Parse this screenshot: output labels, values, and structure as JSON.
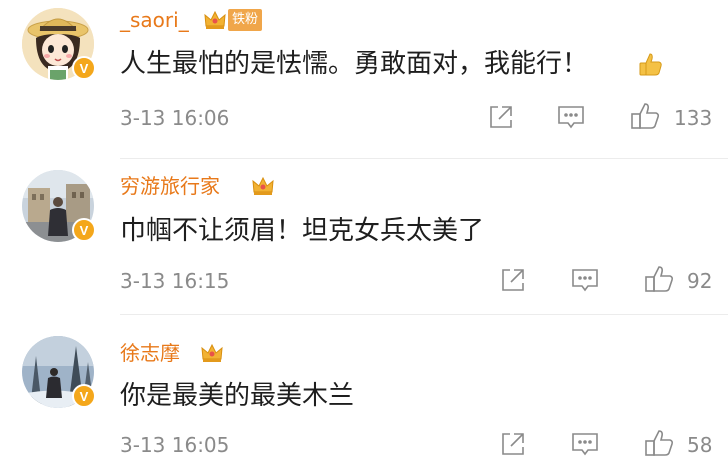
{
  "comments": [
    {
      "username": "_saori_",
      "fan_tag": "铁粉",
      "content": "人生最怕的是怯懦。勇敢面对，我能行！",
      "timestamp": "3-13 16:06",
      "likes": "133",
      "avatar_icon": "cartoon-girl-avatar",
      "content_emoji": "thumbs-up-emoji"
    },
    {
      "username": "穷游旅行家",
      "content": "巾帼不让须眉！坦克女兵太美了",
      "timestamp": "3-13 16:15",
      "likes": "92",
      "avatar_icon": "street-photo-avatar"
    },
    {
      "username": "徐志摩",
      "content": "你是最美的最美木兰",
      "timestamp": "3-13 16:05",
      "likes": "58",
      "avatar_icon": "snowy-trees-avatar"
    }
  ],
  "verified_badge": "V",
  "icons": {
    "share": "share-icon",
    "comment": "comment-icon",
    "like": "like-icon",
    "member": "crown-icon"
  },
  "colors": {
    "username": "#e8791a",
    "text": "#1e1e1e",
    "meta": "#8a8a8a",
    "badge": "#f4a71b",
    "fan_tag": "#f0a64a"
  }
}
